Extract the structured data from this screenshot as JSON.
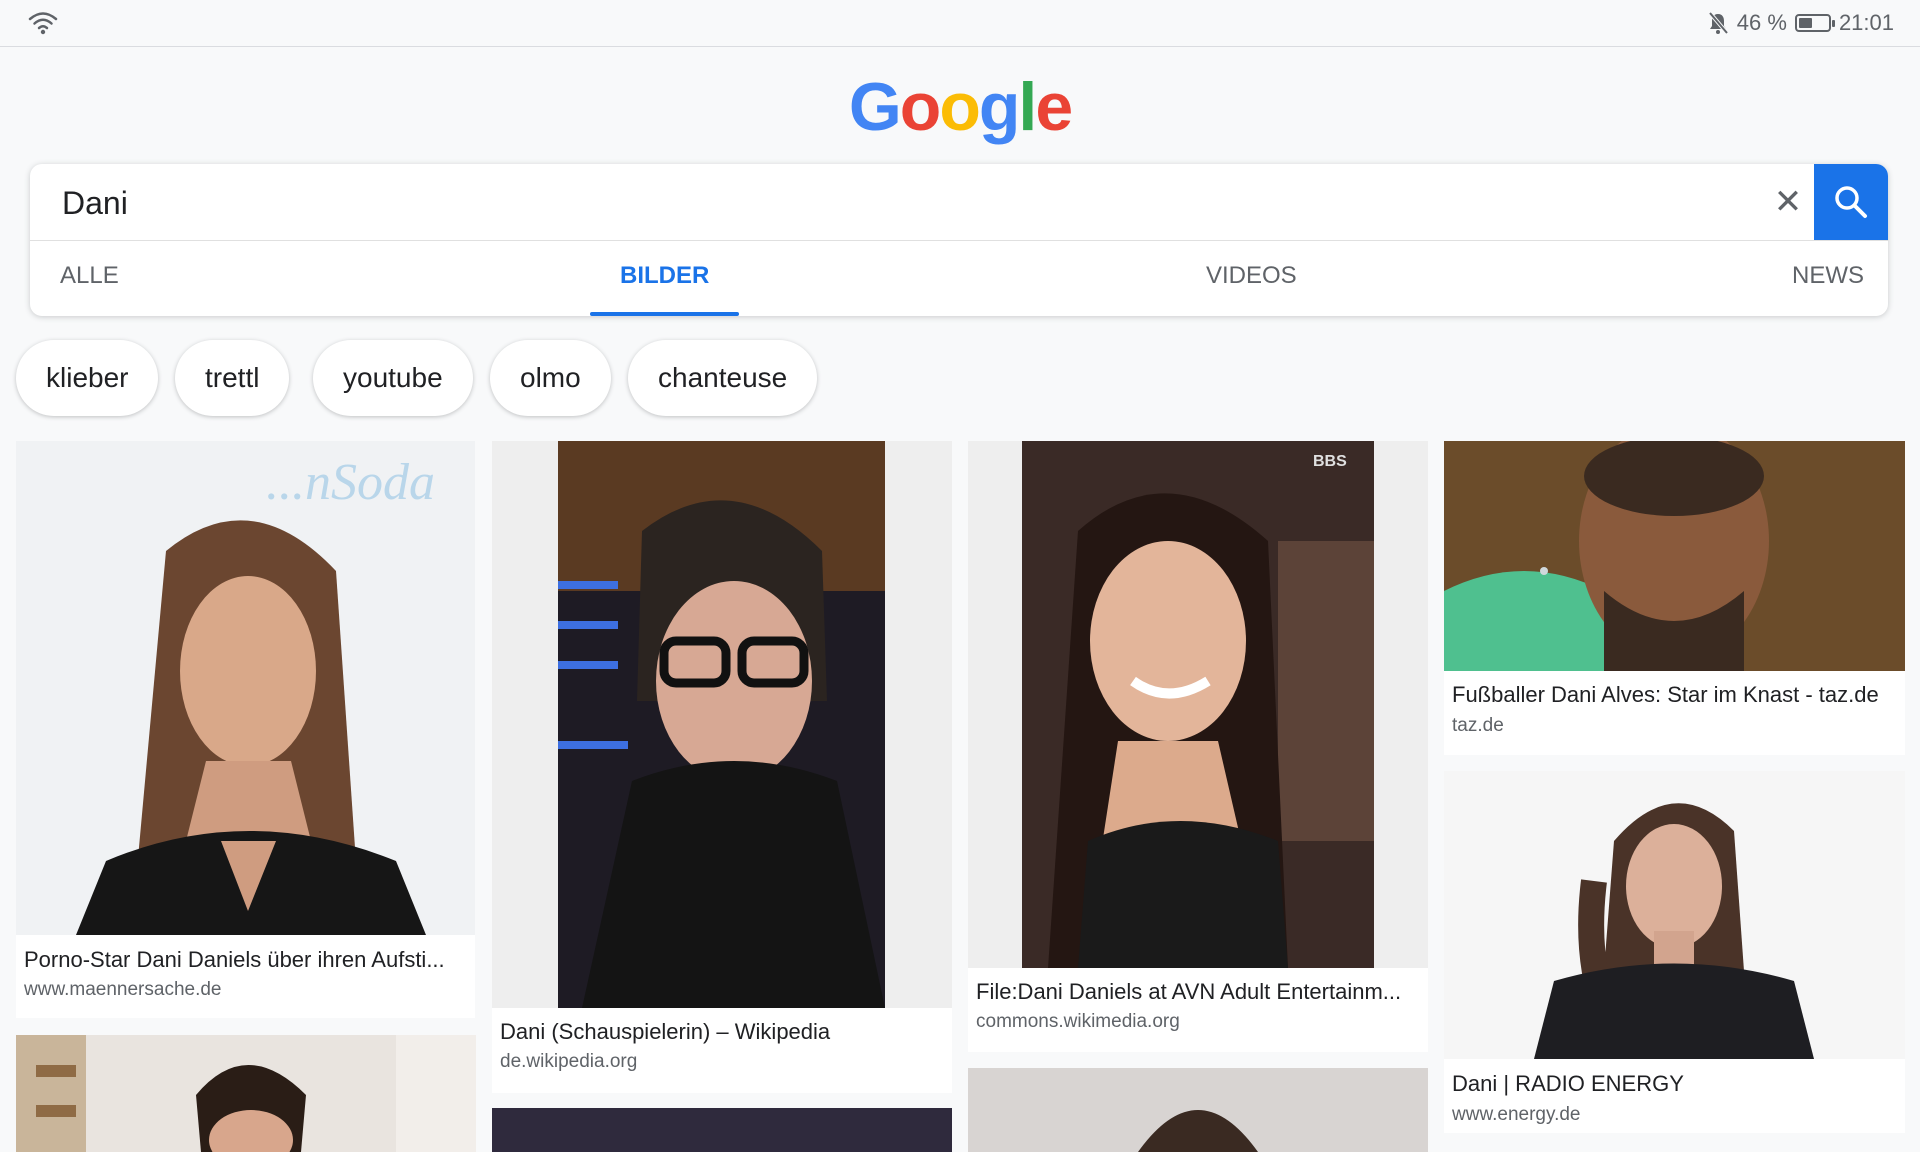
{
  "status_bar": {
    "battery_text": "46 %",
    "battery_level": 0.46,
    "time": "21:01",
    "icons": [
      "wifi-icon",
      "mute-bell-icon",
      "battery-icon"
    ]
  },
  "logo": {
    "letters": [
      "G",
      "o",
      "o",
      "g",
      "l",
      "e"
    ],
    "colors": [
      "#4285F4",
      "#EA4335",
      "#FBBC05",
      "#4285F4",
      "#34A853",
      "#EA4335"
    ]
  },
  "search": {
    "value": "Dani",
    "clear_icon": "close-icon",
    "search_icon": "search-icon"
  },
  "tabs": [
    {
      "label": "ALLE",
      "active": false
    },
    {
      "label": "BILDER",
      "active": true
    },
    {
      "label": "VIDEOS",
      "active": false
    },
    {
      "label": "NEWS",
      "active": false
    }
  ],
  "chips": [
    "klieber",
    "trettl",
    "youtube",
    "olmo",
    "chanteuse"
  ],
  "results": [
    {
      "title": "Porno-Star Dani Daniels über ihren Aufsti...",
      "source": "www.maennersache.de"
    },
    {
      "title": "Dani (Schauspielerin) – Wikipedia",
      "source": "de.wikipedia.org"
    },
    {
      "title": "File:Dani Daniels at AVN Adult Entertainm...",
      "source": "commons.wikimedia.org"
    },
    {
      "title": "Fußballer Dani Alves: Star im Knast - taz.de",
      "source": "taz.de"
    },
    {
      "title": "Dani | RADIO ENERGY",
      "source": "www.energy.de"
    }
  ],
  "colors": {
    "accent": "#1a73e8",
    "text": "#202124",
    "muted": "#5f6368",
    "background": "#f8f9fa"
  }
}
